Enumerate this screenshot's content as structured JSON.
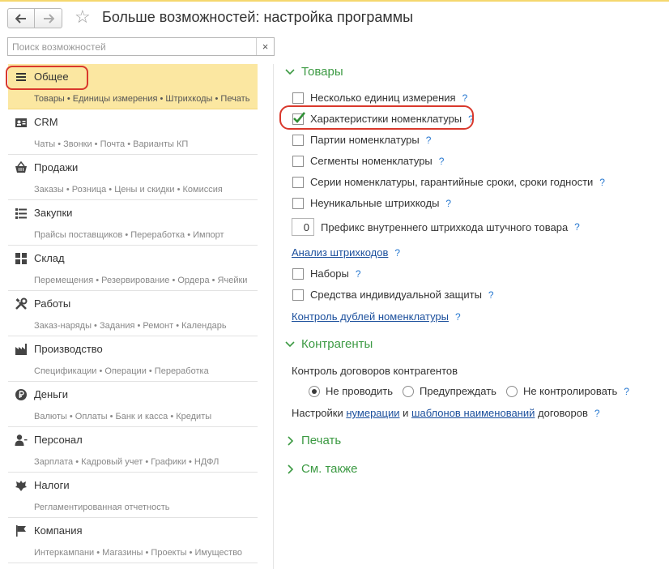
{
  "header": {
    "back_icon": "arrow-left-icon",
    "forward_icon": "arrow-right-icon",
    "star_icon": "star-icon",
    "title": "Больше возможностей: настройка программы"
  },
  "search": {
    "placeholder": "Поиск возможностей",
    "value": "",
    "clear_label": "×"
  },
  "sidebar": {
    "items": [
      {
        "title": "Общее",
        "sub": "Товары • Единицы измерения • Штрихкоды • Печать",
        "icon": "list-icon",
        "active": true
      },
      {
        "title": "CRM",
        "sub": "Чаты • Звонки • Почта • Варианты КП",
        "icon": "contact-card-icon"
      },
      {
        "title": "Продажи",
        "sub": "Заказы • Розница • Цены и скидки • Комиссия",
        "icon": "basket-icon"
      },
      {
        "title": "Закупки",
        "sub": "Прайсы поставщиков • Переработка • Импорт",
        "icon": "purchase-list-icon"
      },
      {
        "title": "Склад",
        "sub": "Перемещения • Резервирование • Ордера • Ячейки",
        "icon": "warehouse-grid-icon"
      },
      {
        "title": "Работы",
        "sub": "Заказ-наряды • Задания • Ремонт • Календарь",
        "icon": "tools-icon"
      },
      {
        "title": "Производство",
        "sub": "Спецификации • Операции • Переработка",
        "icon": "factory-icon"
      },
      {
        "title": "Деньги",
        "sub": "Валюты • Оплаты • Банк и касса • Кредиты",
        "icon": "ruble-icon"
      },
      {
        "title": "Персонал",
        "sub": "Зарплата • Кадровый учет • Графики • НДФЛ",
        "icon": "person-icon"
      },
      {
        "title": "Налоги",
        "sub": "Регламентированная отчетность",
        "icon": "emblem-icon"
      },
      {
        "title": "Компания",
        "sub": "Интеркампани • Магазины • Проекты • Имущество",
        "icon": "flag-icon"
      }
    ]
  },
  "main": {
    "goods": {
      "title": "Товары",
      "multi_units": "Несколько единиц измерения",
      "characteristics": "Характеристики номенклатуры",
      "batches": "Партии номенклатуры",
      "segments": "Сегменты номенклатуры",
      "series": "Серии номенклатуры, гарантийные сроки, сроки годности",
      "nonunique_barcodes": "Неуникальные штрихкоды",
      "prefix_value": "0",
      "prefix_label": "Префикс внутреннего штрихкода штучного товара",
      "barcode_analysis": "Анализ штрихкодов",
      "kits": "Наборы",
      "ppe": "Средства индивидуальной защиты",
      "duplicates_control": "Контроль дублей номенклатуры"
    },
    "counterparties": {
      "title": "Контрагенты",
      "contracts_control": "Контроль договоров контрагентов",
      "opt1": "Не проводить",
      "opt2": "Предупреждать",
      "opt3": "Не контролировать",
      "settings_prefix": "Настройки",
      "numbering_link": "нумерации",
      "and": "и",
      "templates_link": "шаблонов наименований",
      "settings_suffix": "договоров"
    },
    "print": {
      "title": "Печать"
    },
    "see_also": {
      "title": "См. также"
    },
    "help_mark": "?"
  },
  "colors": {
    "accent_green": "#3c9a43",
    "link_blue": "#1b4f9c",
    "highlight": "#fbe7a1",
    "annotation_red": "#d9382c"
  }
}
